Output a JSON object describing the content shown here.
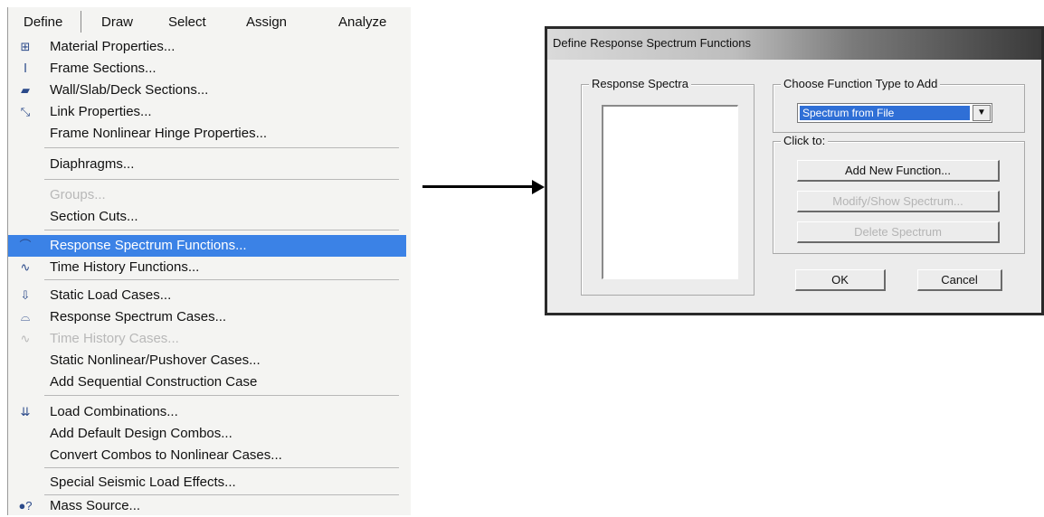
{
  "menubar": {
    "items": [
      "Define",
      "Draw",
      "Select",
      "Assign",
      "Analyze"
    ]
  },
  "menu": {
    "items": [
      {
        "label": "Material Properties...",
        "icon": "material-icon"
      },
      {
        "label": "Frame Sections...",
        "icon": "frame-section-icon"
      },
      {
        "label": "Wall/Slab/Deck Sections...",
        "icon": "wall-slab-icon"
      },
      {
        "label": "Link Properties...",
        "icon": "link-icon"
      },
      {
        "label": "Frame Nonlinear Hinge Properties...",
        "icon": ""
      },
      {
        "label": "Diaphragms...",
        "icon": ""
      },
      {
        "label": "Groups...",
        "icon": "",
        "disabled": true
      },
      {
        "label": "Section Cuts...",
        "icon": ""
      },
      {
        "label": "Response Spectrum Functions...",
        "icon": "response-spectrum-icon",
        "highlighted": true
      },
      {
        "label": "Time History Functions...",
        "icon": "time-history-icon"
      },
      {
        "label": "Static Load Cases...",
        "icon": "static-load-icon"
      },
      {
        "label": "Response Spectrum Cases...",
        "icon": "response-cases-icon"
      },
      {
        "label": "Time History Cases...",
        "icon": "time-history-cases-icon",
        "disabled": true
      },
      {
        "label": "Static Nonlinear/Pushover Cases...",
        "icon": ""
      },
      {
        "label": "Add Sequential Construction Case",
        "icon": ""
      },
      {
        "label": "Load Combinations...",
        "icon": "load-combination-icon"
      },
      {
        "label": "Add Default Design Combos...",
        "icon": ""
      },
      {
        "label": "Convert Combos to Nonlinear Cases...",
        "icon": ""
      },
      {
        "label": "Special Seismic Load Effects...",
        "icon": ""
      },
      {
        "label": "Mass Source...",
        "icon": "mass-source-icon"
      }
    ]
  },
  "dialog": {
    "title": "Define Response Spectrum Functions",
    "response_spectra_label": "Response Spectra",
    "function_type_label": "Choose Function Type to Add",
    "function_type_value": "Spectrum from File",
    "click_to_label": "Click to:",
    "add_button": "Add New Function...",
    "modify_button": "Modify/Show Spectrum...",
    "delete_button": "Delete Spectrum",
    "ok_button": "OK",
    "cancel_button": "Cancel"
  },
  "colors": {
    "highlight": "#3b82e6",
    "selection": "#2f6fd6"
  }
}
